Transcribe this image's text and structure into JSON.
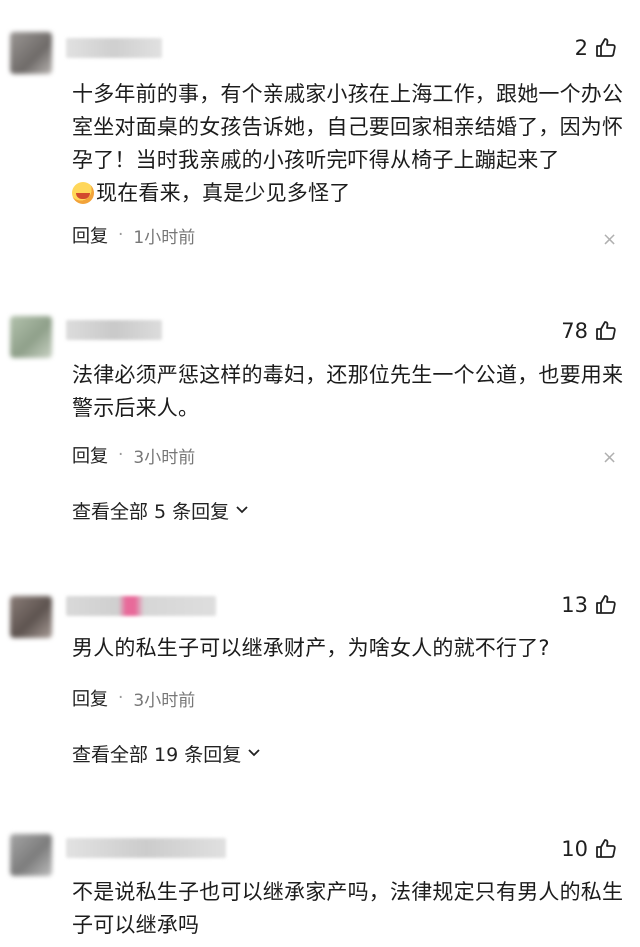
{
  "comments": [
    {
      "likes": "2",
      "text": "十多年前的事，有个亲戚家小孩在上海工作，跟她一个办公室坐对面桌的女孩告诉她，自己要回家相亲结婚了，因为怀孕了！当时我亲戚的小孩听完吓得从椅子上蹦起来了",
      "text_tail": "现在看来，真是少见多怪了",
      "emoji_icon": "laughing-crying-face-icon",
      "reply_label": "回复",
      "time": "1小时前"
    },
    {
      "likes": "78",
      "text": "法律必须严惩这样的毒妇，还那位先生一个公道，也要用来警示后来人。",
      "reply_label": "回复",
      "time": "3小时前",
      "view_all": "查看全部 5 条回复"
    },
    {
      "likes": "13",
      "text": "男人的私生子可以继承财产，为啥女人的就不行了?",
      "reply_label": "回复",
      "time": "3小时前",
      "view_all": "查看全部 19 条回复"
    },
    {
      "likes": "10",
      "text": "不是说私生子也可以继承家产吗，法律规定只有男人的私生子可以继承吗"
    }
  ],
  "colors": {
    "avatar_1": "#8e8a88",
    "avatar_2": "#a7b5a0",
    "avatar_3": "#7f7470",
    "avatar_4": "#9a9a9a",
    "name_bar": "#d9d9d9",
    "name_bar_accent": "#e86a9a"
  }
}
